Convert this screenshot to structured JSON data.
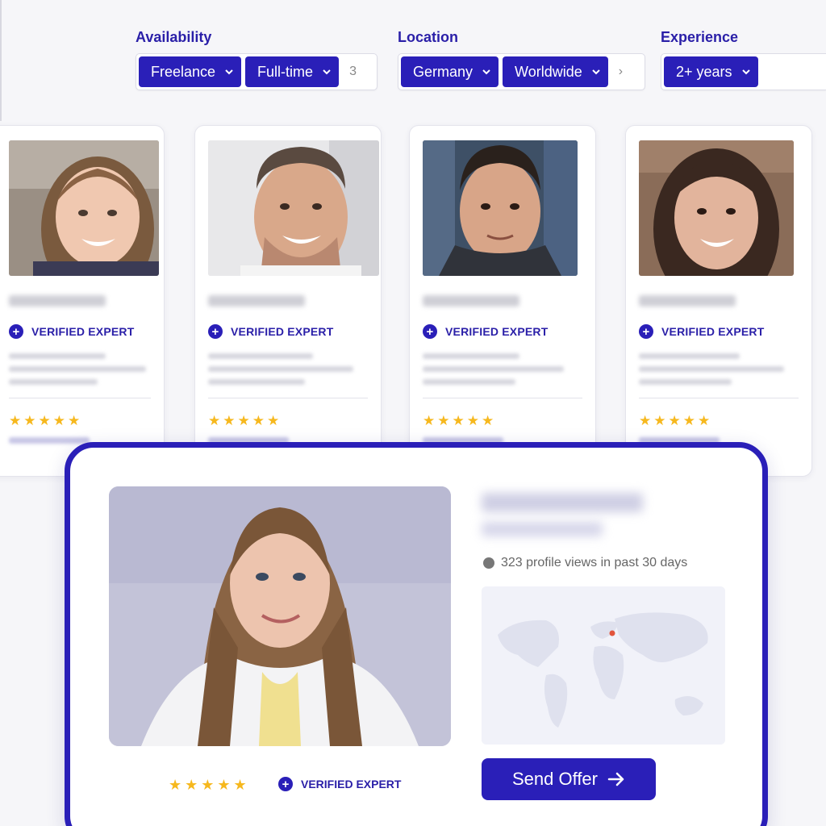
{
  "filters": [
    {
      "label": "Availability",
      "chips": [
        "Freelance",
        "Full-time"
      ],
      "more": "3"
    },
    {
      "label": "Location",
      "chips": [
        "Germany",
        "Worldwide"
      ],
      "more": "›"
    },
    {
      "label": "Experience",
      "chips": [
        "2+ years"
      ],
      "more": ""
    }
  ],
  "cards": [
    {
      "badge": "VERIFIED EXPERT",
      "stars": "★★★★★"
    },
    {
      "badge": "VERIFIED EXPERT",
      "stars": "★★★★★"
    },
    {
      "badge": "VERIFIED EXPERT",
      "stars": "★★★★★"
    },
    {
      "badge": "VERIFIED EXPERT",
      "stars": "★★★★★"
    }
  ],
  "featured": {
    "profile_views": "323 profile views in past 30 days",
    "badge": "VERIFIED EXPERT",
    "stars": "★★★★★",
    "cta_label": "Send Offer",
    "badge_icon": "+"
  },
  "colors": {
    "accent": "#2a1fb8",
    "star": "#f6b81e",
    "map_marker": "#e2553c"
  },
  "icons": {
    "chip_dropdown": "chevron-down-icon",
    "verified": "plus-circle-icon",
    "views": "globe-icon",
    "cta": "arrow-right-icon"
  }
}
